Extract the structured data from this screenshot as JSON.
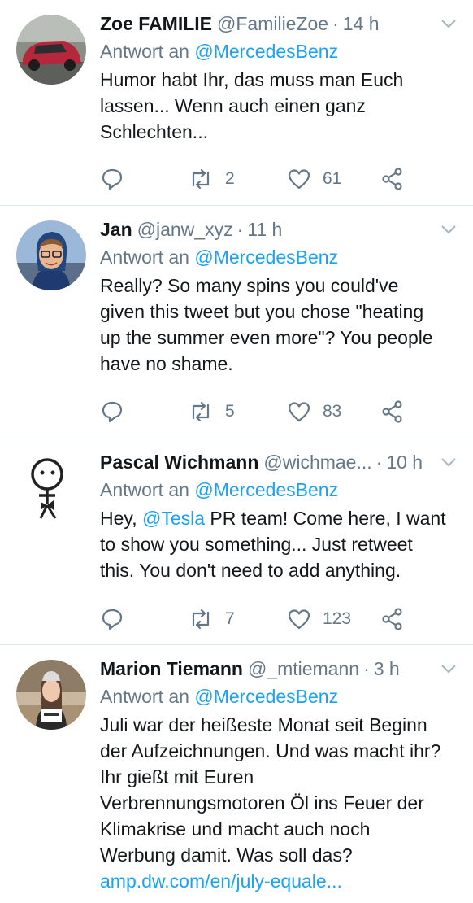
{
  "reply_prefix": "Antwort an",
  "tweets": [
    {
      "name": "Zoe FAMILIE",
      "handle": "@FamilieZoe",
      "time": "14 h",
      "reply_to": "@MercedesBenz",
      "text": "Humor habt Ihr, das muss man Euch\nlassen... Wenn auch einen ganz\nSchlechten...",
      "retweets": "2",
      "likes": "61",
      "avatar": "red-car-photo"
    },
    {
      "name": "Jan",
      "handle": "@janw_xyz",
      "time": "11 h",
      "reply_to": "@MercedesBenz",
      "text": "Really? So many spins you could've\ngiven this tweet but you chose \"heating\nup the summer even more\"? You people\nhave no shame.",
      "retweets": "5",
      "likes": "83",
      "avatar": "man-with-glasses-photo"
    },
    {
      "name": "Pascal Wichmann",
      "handle": "@wichmae...",
      "time": "10 h",
      "reply_to": "@MercedesBenz",
      "text_before": "Hey, ",
      "text_mention": "@Tesla",
      "text_after": " PR team! Come here, I want\nto show you something... Just retweet\nthis. You don't need to add anything.",
      "retweets": "7",
      "likes": "123",
      "avatar": "stick-figure-drawing"
    },
    {
      "name": "Marion Tiemann",
      "handle": "@_mtiemann",
      "time": "3 h",
      "reply_to": "@MercedesBenz",
      "text": "Juli war der heißeste Monat seit Beginn\nder Aufzeichnungen. Und was macht ihr?\nIhr gießt mit Euren\nVerbrennungsmotoren Öl ins Feuer der\nKlimakrise und macht auch noch\nWerbung damit. Was soll das?",
      "link": "amp.dw.com/en/july-equale...",
      "avatar": "woman-with-sign-photo"
    }
  ],
  "colors": {
    "link": "#1da1f2",
    "muted": "#657786",
    "divider": "#e1e8ed"
  }
}
